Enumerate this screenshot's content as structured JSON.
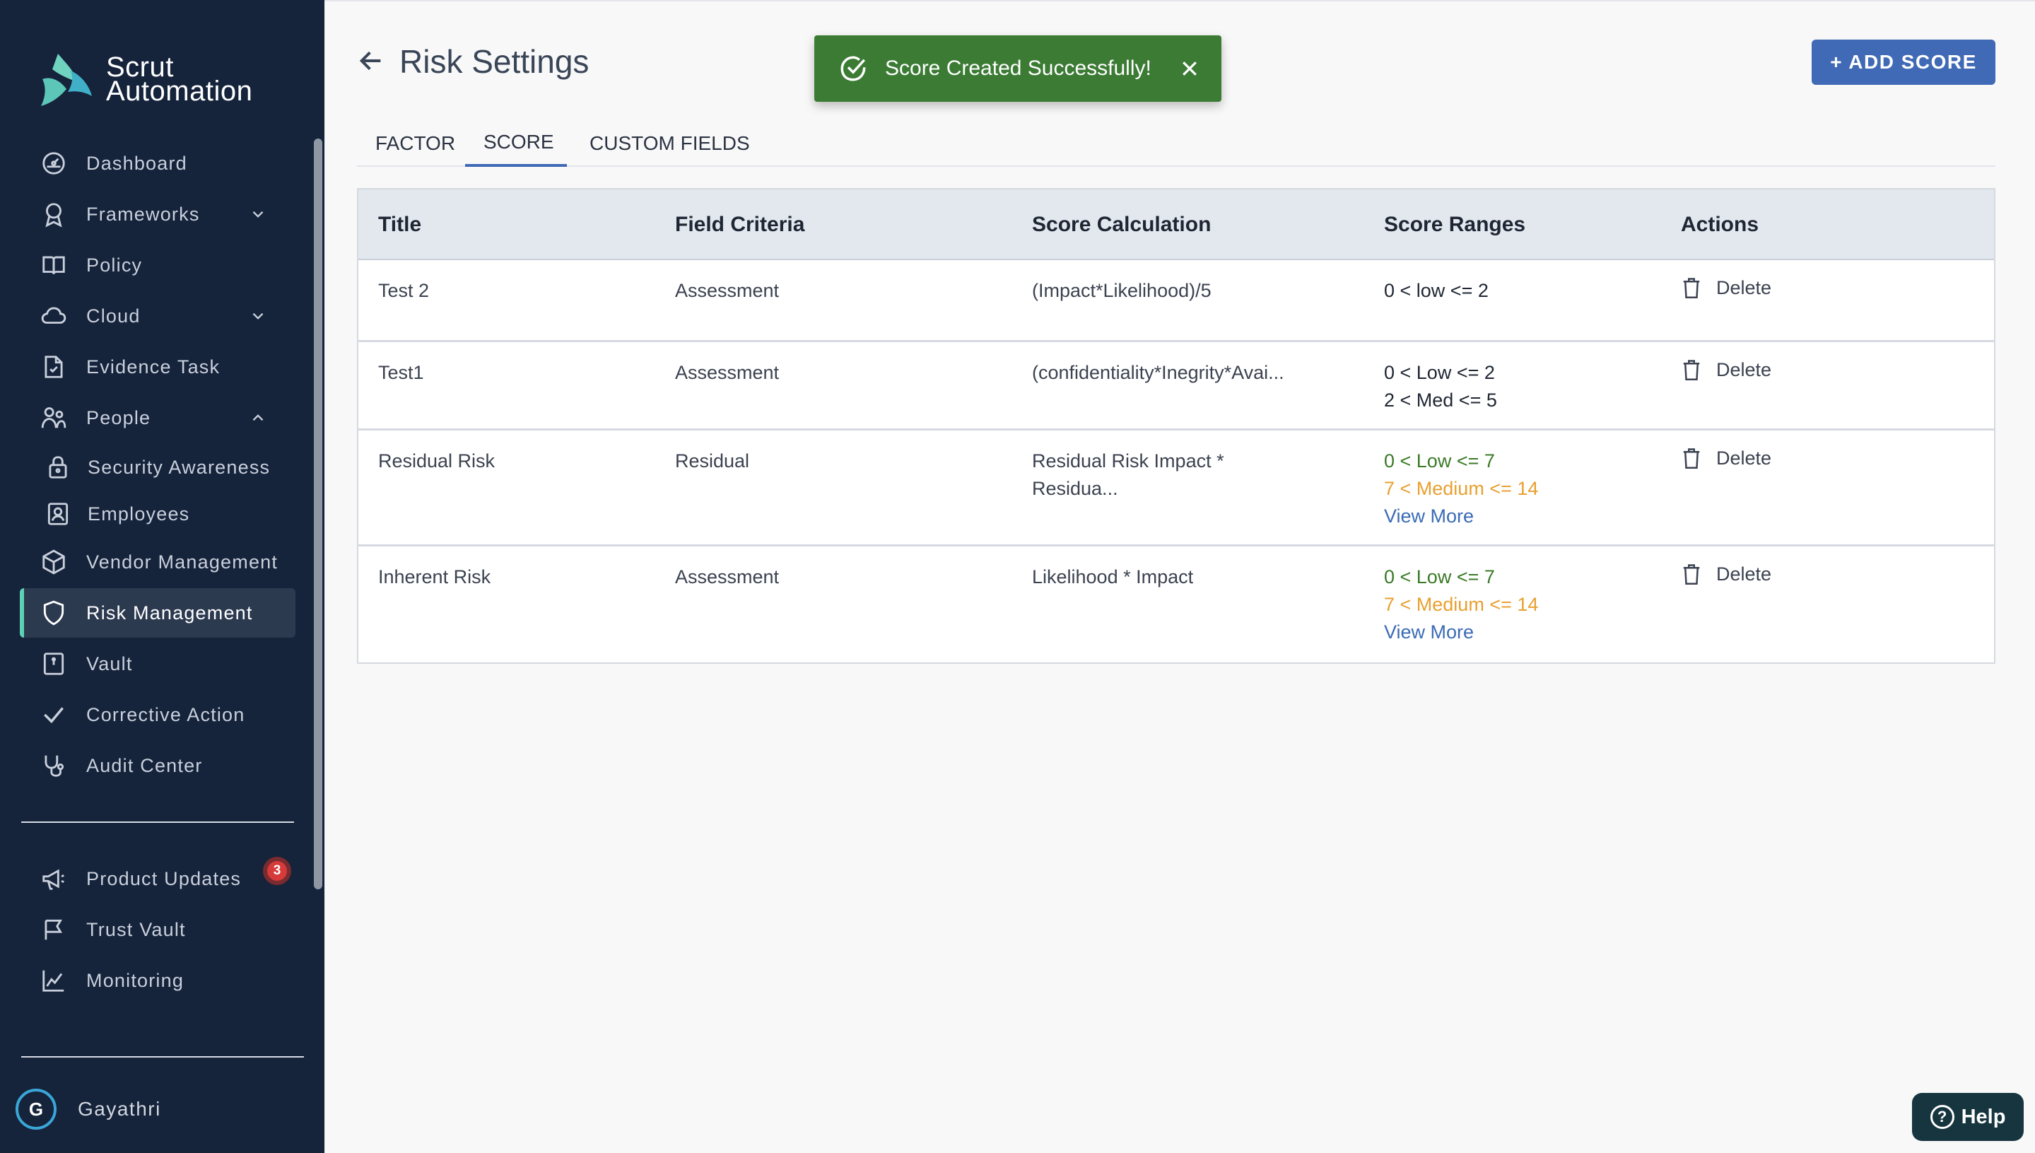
{
  "brand": {
    "line1": "Scrut",
    "line2": "Automation"
  },
  "sidebar": {
    "items": [
      {
        "label": "Dashboard",
        "icon": "dashboard-icon"
      },
      {
        "label": "Frameworks",
        "icon": "award-icon",
        "chevron": "down"
      },
      {
        "label": "Policy",
        "icon": "book-icon"
      },
      {
        "label": "Cloud",
        "icon": "cloud-icon",
        "chevron": "down"
      },
      {
        "label": "Evidence Task",
        "icon": "file-check-icon"
      },
      {
        "label": "People",
        "icon": "people-icon",
        "chevron": "up"
      },
      {
        "label": "Security Awareness",
        "icon": "lock-icon"
      },
      {
        "label": "Employees",
        "icon": "id-badge-icon"
      },
      {
        "label": "Vendor Management",
        "icon": "box-icon"
      },
      {
        "label": "Risk Management",
        "icon": "shield-icon",
        "active": true
      },
      {
        "label": "Vault",
        "icon": "vault-icon"
      },
      {
        "label": "Corrective Action",
        "icon": "check-icon"
      },
      {
        "label": "Audit Center",
        "icon": "stethoscope-icon"
      }
    ],
    "bottom_items": [
      {
        "label": "Product Updates",
        "icon": "megaphone-icon",
        "badge": "3"
      },
      {
        "label": "Trust Vault",
        "icon": "flag-icon"
      },
      {
        "label": "Monitoring",
        "icon": "chart-line-icon"
      }
    ],
    "user": {
      "initial": "G",
      "name": "Gayathri"
    }
  },
  "header": {
    "title": "Risk Settings",
    "add_button": "+ ADD SCORE"
  },
  "tabs": [
    {
      "label": "FACTOR"
    },
    {
      "label": "SCORE",
      "active": true
    },
    {
      "label": "CUSTOM FIELDS"
    }
  ],
  "toast": {
    "message": "Score Created Successfully!"
  },
  "table": {
    "columns": [
      "Title",
      "Field Criteria",
      "Score Calculation",
      "Score Ranges",
      "Actions"
    ],
    "rows": [
      {
        "title": "Test 2",
        "criteria": "Assessment",
        "calc1": "(Impact*Likelihood)/5",
        "calc2": "",
        "range1": "0 < low <= 2",
        "range2": "",
        "more": "",
        "action": "Delete"
      },
      {
        "title": "Test1",
        "criteria": "Assessment",
        "calc1": "(confidentiality*Inegrity*Avai...",
        "calc2": "",
        "range1": "0 < Low <= 2",
        "range2": "2 < Med <= 5",
        "more": "",
        "action": "Delete"
      },
      {
        "title": "Residual Risk",
        "criteria": "Residual",
        "calc1": "Residual Risk Impact *",
        "calc2": "Residua...",
        "range1": "0 < Low <= 7",
        "range2": "7 < Medium <= 14",
        "more": "View More",
        "action": "Delete"
      },
      {
        "title": "Inherent Risk",
        "criteria": "Assessment",
        "calc1": "Likelihood * Impact",
        "calc2": "",
        "range1": "0 < Low <= 7",
        "range2": "7 < Medium <= 14",
        "more": "View More",
        "action": "Delete"
      }
    ]
  },
  "help": {
    "label": "Help"
  },
  "colors": {
    "sidebar_bg": "#15233b",
    "accent_blue": "#4069b6",
    "toast_green": "#3b7b34",
    "range_low": "#3b7a27",
    "range_medium": "#e8a030",
    "active_indicator": "#5cd1b4"
  }
}
